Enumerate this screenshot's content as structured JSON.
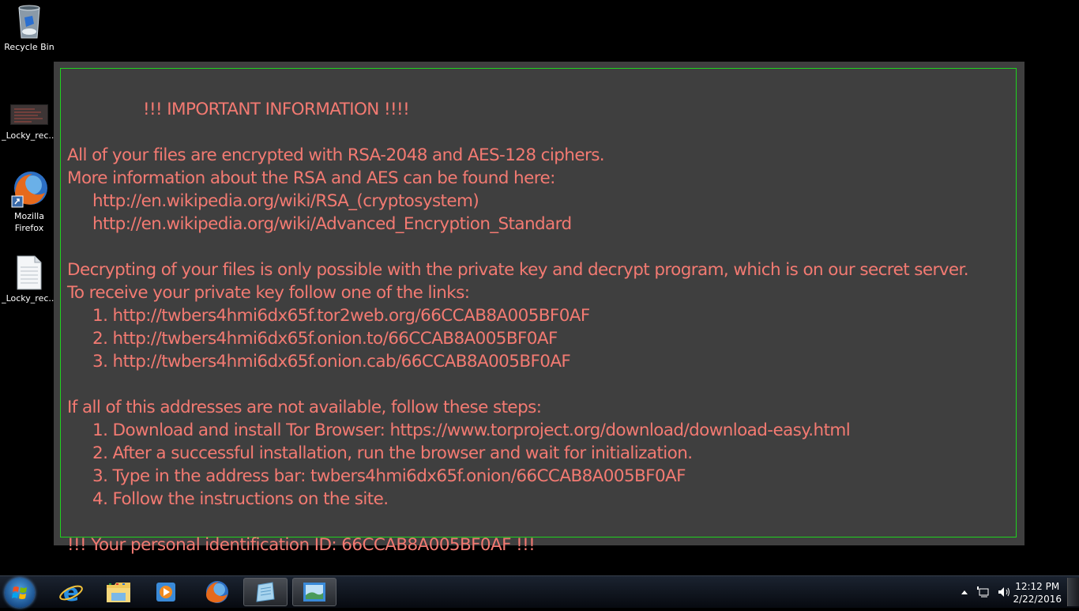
{
  "desktop": {
    "icons": [
      {
        "label": "Recycle Bin",
        "icon": "recycle-bin-icon"
      },
      {
        "label": "_Locky_rec...",
        "icon": "image-thumbnail-icon"
      },
      {
        "label": "Mozilla Firefox",
        "label_line1": "Mozilla",
        "label_line2": "Firefox",
        "icon": "firefox-shortcut-icon"
      },
      {
        "label": "_Locky_rec...",
        "icon": "text-document-icon"
      }
    ]
  },
  "ransom_note": {
    "title": "!!! IMPORTANT INFORMATION !!!!",
    "lines": [
      "All of your files are encrypted with RSA-2048 and AES-128 ciphers.",
      "More information about the RSA and AES can be found here:",
      "http://en.wikipedia.org/wiki/RSA_(cryptosystem)",
      "http://en.wikipedia.org/wiki/Advanced_Encryption_Standard",
      "Decrypting of your files is only possible with the private key and decrypt program, which is on our secret server.",
      "To receive your private key follow one of the links:",
      "1. http://twbers4hmi6dx65f.tor2web.org/66CCAB8A005BF0AF",
      "2. http://twbers4hmi6dx65f.onion.to/66CCAB8A005BF0AF",
      "3. http://twbers4hmi6dx65f.onion.cab/66CCAB8A005BF0AF",
      "If all of this addresses are not available, follow these steps:",
      "1. Download and install Tor Browser: https://www.torproject.org/download/download-easy.html",
      "2. After a successful installation, run the browser and wait for initialization.",
      "3. Type in the address bar: twbers4hmi6dx65f.onion/66CCAB8A005BF0AF",
      "4. Follow the instructions on the site.",
      "!!! Your personal identification ID: 66CCAB8A005BF0AF !!!"
    ],
    "text_color": "#f37a72",
    "border_color": "#1fd21f",
    "background_color": "#3f3f3f"
  },
  "taskbar": {
    "buttons": [
      {
        "name": "start-button",
        "icon": "windows-logo-icon"
      },
      {
        "name": "internet-explorer",
        "icon": "internet-explorer-icon"
      },
      {
        "name": "windows-explorer",
        "icon": "folder-icon"
      },
      {
        "name": "media-player",
        "icon": "media-player-icon"
      },
      {
        "name": "firefox",
        "icon": "firefox-icon"
      },
      {
        "name": "notepad",
        "icon": "notepad-icon",
        "active": true
      },
      {
        "name": "photo-viewer",
        "icon": "photo-viewer-icon",
        "active": true
      }
    ],
    "tray": {
      "time": "12:12 PM",
      "date": "2/22/2016"
    }
  }
}
